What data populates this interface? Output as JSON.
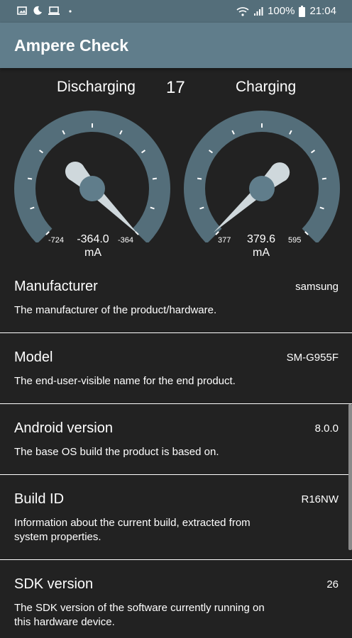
{
  "status_bar": {
    "battery": "100%",
    "time": "21:04",
    "icons": [
      "image-icon",
      "moon-icon",
      "laptop-icon",
      "dot-icon",
      "wifi-icon",
      "signal-icon",
      "battery-icon"
    ]
  },
  "app_bar": {
    "title": "Ampere Check"
  },
  "gauges": {
    "count": "17",
    "discharging": {
      "label": "Discharging",
      "min": "-724",
      "max": "-364",
      "value": "-364.0",
      "unit": "mA",
      "level": 1.0
    },
    "charging": {
      "label": "Charging",
      "min": "377",
      "max": "595",
      "value": "379.6",
      "unit": "mA",
      "level": 0.01
    }
  },
  "colors": {
    "status_bar": "#546e7a",
    "app_bar": "#607d8b",
    "background": "#222222",
    "gauge": "#546e7a",
    "needle": "#cfd8dc"
  },
  "items": [
    {
      "title": "Manufacturer",
      "value": "samsung",
      "description": "The manufacturer of the product/hardware."
    },
    {
      "title": "Model",
      "value": "SM-G955F",
      "description": "The end-user-visible name for the end product."
    },
    {
      "title": "Android version",
      "value": "8.0.0",
      "description": "The base OS build the product is based on."
    },
    {
      "title": "Build ID",
      "value": "R16NW",
      "description": "Information about the current build, extracted from system properties."
    },
    {
      "title": "SDK version",
      "value": "26",
      "description": "The SDK version of the software currently running on this hardware device."
    }
  ]
}
